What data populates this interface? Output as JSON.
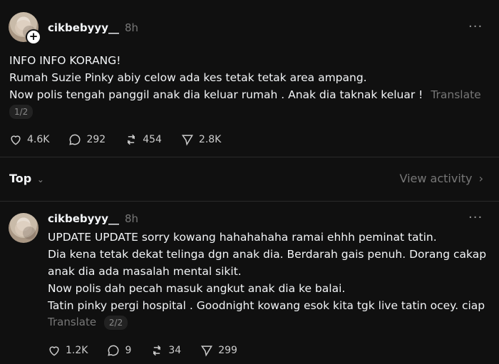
{
  "post1": {
    "username": "cikbebyyy__",
    "time": "8h",
    "lines": [
      "INFO INFO KORANG!",
      "Rumah Suzie Pinky abiy celow ada kes tetak tetak area ampang.",
      "Now polis tengah panggil anak dia keluar rumah . Anak dia taknak keluar !"
    ],
    "translate": "Translate",
    "page": "1/2",
    "likes": "4.6K",
    "comments": "292",
    "reposts": "454",
    "shares": "2.8K"
  },
  "sort": {
    "label": "Top",
    "view_activity": "View activity"
  },
  "post2": {
    "username": "cikbebyyy__",
    "time": "8h",
    "lines": [
      "UPDATE UPDATE sorry kowang hahahahaha ramai ehhh peminat tatin.",
      "Dia kena tetak dekat telinga dgn anak dia. Berdarah gais penuh. Dorang cakap",
      "anak dia ada masalah mental sikit.",
      "Now polis dah pecah masuk angkut anak dia ke balai.",
      "Tatin pinky pergi hospital . Goodnight kowang esok kita tgk live tatin ocey. ciap"
    ],
    "translate": "Translate",
    "page": "2/2",
    "likes": "1.2K",
    "comments": "9",
    "reposts": "34",
    "shares": "299"
  }
}
